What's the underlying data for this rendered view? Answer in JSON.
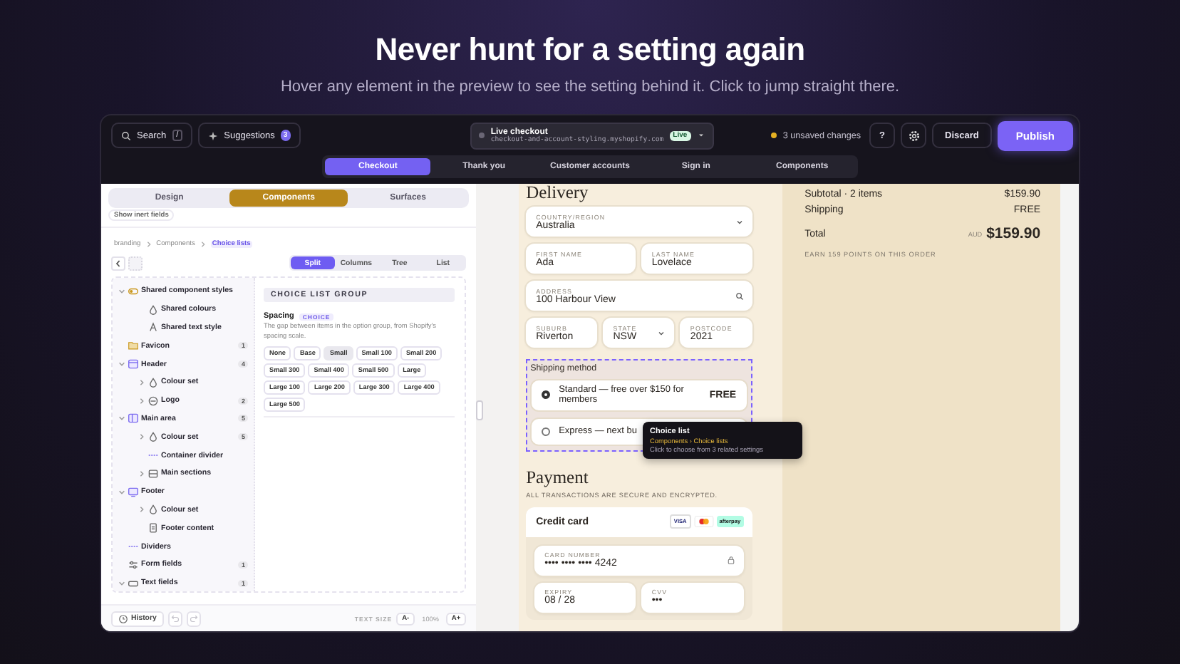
{
  "hero": {
    "title": "Never hunt for a setting again",
    "subtitle": "Hover any element in the preview to see the setting behind it. Click to jump straight there."
  },
  "topbar": {
    "search": {
      "label": "Search",
      "shortcut": "/"
    },
    "suggestions": {
      "label": "Suggestions",
      "count": "3"
    },
    "store": {
      "title": "Live checkout",
      "domain": "checkout-and-account-styling.myshopify.com",
      "status": "Live"
    },
    "unsaved": "3 unsaved changes",
    "help": "?",
    "discard": "Discard",
    "publish": "Publish"
  },
  "page_tabs": [
    {
      "label": "Checkout",
      "selected": true
    },
    {
      "label": "Thank you",
      "selected": false
    },
    {
      "label": "Customer accounts",
      "selected": false
    },
    {
      "label": "Sign in",
      "selected": false
    },
    {
      "label": "Components",
      "selected": false
    }
  ],
  "editor": {
    "mode_tabs": [
      {
        "label": "Design",
        "selected": false
      },
      {
        "label": "Components",
        "selected": true
      },
      {
        "label": "Surfaces",
        "selected": false
      }
    ],
    "inert_toggle": "Show inert fields",
    "breadcrumb": [
      {
        "label": "branding",
        "selected": false
      },
      {
        "label": "Components",
        "selected": false
      },
      {
        "label": "Choice lists",
        "selected": true
      }
    ],
    "view_tabs": [
      {
        "label": "Split",
        "selected": true
      },
      {
        "label": "Columns",
        "selected": false
      },
      {
        "label": "Tree",
        "selected": false
      },
      {
        "label": "List",
        "selected": false
      }
    ],
    "tree": [
      {
        "label": "Shared component styles",
        "kind": "styles",
        "expanded": true,
        "children": [
          {
            "label": "Shared colours",
            "kind": "colour"
          },
          {
            "label": "Shared text style",
            "kind": "text"
          }
        ]
      },
      {
        "label": "Favicon",
        "kind": "favicon",
        "count": "1"
      },
      {
        "label": "Header",
        "kind": "header",
        "count": "4",
        "expanded": true,
        "children": [
          {
            "label": "Colour set",
            "kind": "colour",
            "expanded": false
          },
          {
            "label": "Logo",
            "kind": "logo",
            "count": "2",
            "expanded": false
          }
        ]
      },
      {
        "label": "Main area",
        "kind": "area",
        "count": "5",
        "expanded": true,
        "children": [
          {
            "label": "Colour set",
            "kind": "colour",
            "count": "5",
            "expanded": false
          },
          {
            "label": "Container divider",
            "kind": "divider"
          },
          {
            "label": "Main sections",
            "kind": "sections",
            "expanded": false
          }
        ]
      },
      {
        "label": "Footer",
        "kind": "footer",
        "expanded": true,
        "children": [
          {
            "label": "Colour set",
            "kind": "colour",
            "expanded": false
          },
          {
            "label": "Footer content",
            "kind": "content"
          }
        ]
      },
      {
        "label": "Dividers",
        "kind": "divider"
      },
      {
        "label": "Form fields",
        "kind": "fields",
        "count": "1"
      },
      {
        "label": "Text fields",
        "kind": "textfield",
        "count": "1",
        "expanded": true
      }
    ],
    "group": {
      "title": "CHOICE LIST GROUP",
      "setting": {
        "name": "Spacing",
        "tag": "CHOICE",
        "description": "The gap between items in the option group, from Shopify's spacing scale.",
        "options": [
          {
            "label": "None",
            "selected": false
          },
          {
            "label": "Base",
            "selected": false
          },
          {
            "label": "Small",
            "selected": true
          },
          {
            "label": "Small 100",
            "selected": false
          },
          {
            "label": "Small 200",
            "selected": false
          },
          {
            "label": "Small 300",
            "selected": false
          },
          {
            "label": "Small 400",
            "selected": false
          },
          {
            "label": "Small 500",
            "selected": false
          },
          {
            "label": "Large",
            "selected": false
          },
          {
            "label": "Large 100",
            "selected": false
          },
          {
            "label": "Large 200",
            "selected": false
          },
          {
            "label": "Large 300",
            "selected": false
          },
          {
            "label": "Large 400",
            "selected": false
          },
          {
            "label": "Large 500",
            "selected": false
          }
        ]
      }
    },
    "history": "History",
    "history_controls": [
      {
        "kind": "undo",
        "disabled": true
      },
      {
        "kind": "redo",
        "disabled": true
      }
    ],
    "text_size": {
      "label": "TEXT SIZE",
      "decrease": "A-",
      "value": "100%",
      "increase": "A+"
    }
  },
  "preview": {
    "delivery": {
      "title": "Delivery",
      "rows": [
        [
          {
            "label": "COUNTRY/REGION",
            "value": "Australia",
            "kind": "select"
          }
        ],
        [
          {
            "label": "FIRST NAME",
            "value": "Ada",
            "kind": "text"
          },
          {
            "label": "LAST NAME",
            "value": "Lovelace",
            "kind": "text"
          }
        ],
        [
          {
            "label": "ADDRESS",
            "value": "100 Harbour View",
            "kind": "search"
          }
        ],
        [
          {
            "label": "SUBURB",
            "value": "Riverton",
            "kind": "text"
          },
          {
            "label": "STATE",
            "value": "NSW",
            "kind": "select"
          },
          {
            "label": "POSTCODE",
            "value": "2021",
            "kind": "text"
          }
        ]
      ]
    },
    "shipping": {
      "title": "Shipping method",
      "highlighted": true,
      "options": [
        {
          "label": "Standard — free over $150 for members",
          "price": "FREE",
          "selected": true
        },
        {
          "label": "Express — next bu",
          "selected": false
        }
      ]
    },
    "payment": {
      "title": "Payment",
      "subtitle": "ALL TRANSACTIONS ARE SECURE AND ENCRYPTED.",
      "method": "Credit card",
      "badges": [
        {
          "kind": "visa",
          "label": "VISA"
        },
        {
          "kind": "mastercard"
        },
        {
          "kind": "afterpay",
          "label": "afterpay"
        }
      ],
      "rows": [
        [
          {
            "label": "CARD NUMBER",
            "value": "•••• •••• •••• 4242",
            "kind": "secure"
          }
        ],
        [
          {
            "label": "EXPIRY",
            "value": "08 / 28",
            "kind": "text"
          },
          {
            "label": "CVV",
            "value": "•••",
            "kind": "text"
          }
        ]
      ]
    }
  },
  "summary": {
    "lines": [
      {
        "label": "Subtotal · 2 items",
        "value": "$159.90"
      },
      {
        "label": "Shipping",
        "value": "FREE"
      }
    ],
    "total": {
      "label": "Total",
      "currency": "AUD",
      "value": "$159.90"
    },
    "points": "EARN 159 POINTS ON THIS ORDER"
  },
  "tooltip": {
    "title": "Choice list",
    "path": "Components › Choice lists",
    "hint": "Click to choose from 3 related settings"
  }
}
